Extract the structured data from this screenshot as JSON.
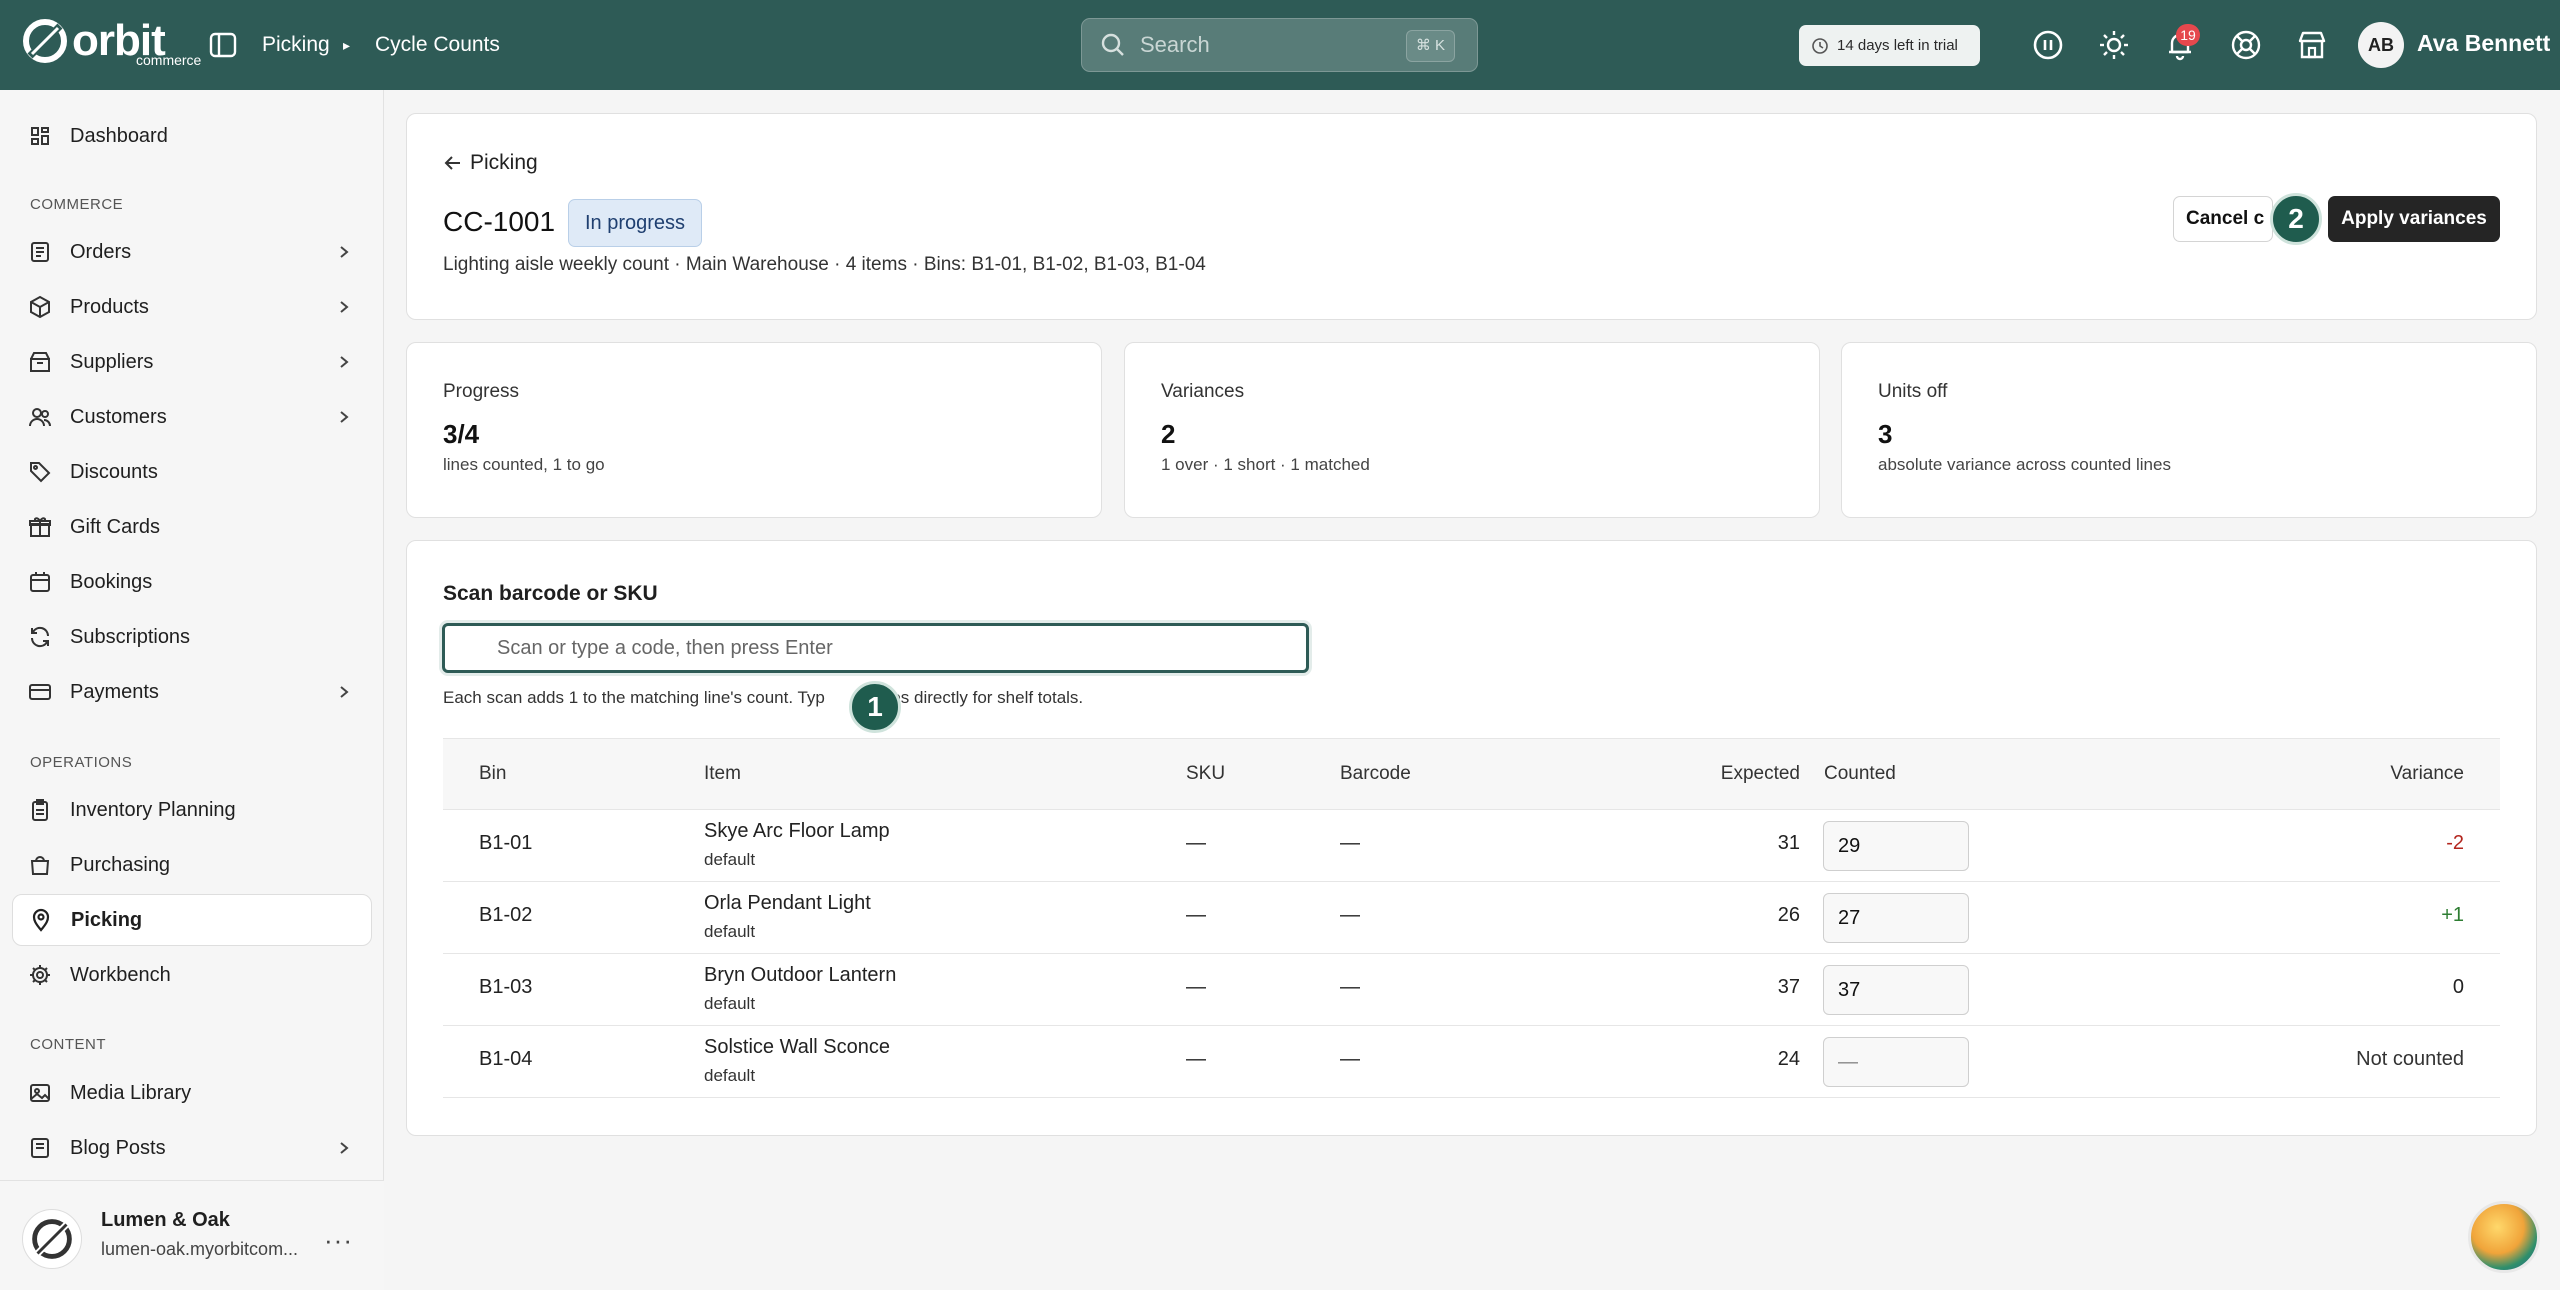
{
  "header": {
    "brand": "orbit",
    "brand_sub": "commerce",
    "breadcrumb": [
      "Picking",
      "Cycle Counts"
    ],
    "search_placeholder": "Search",
    "search_shortcut": "⌘ K",
    "trial_text": "14 days left in trial",
    "notifications_count": "19",
    "user_initials": "AB",
    "user_name": "Ava Bennett"
  },
  "sidebar": {
    "items": [
      {
        "label": "Dashboard",
        "icon": "dashboard-icon"
      },
      {
        "label": "Orders",
        "icon": "orders-icon"
      },
      {
        "label": "Products",
        "icon": "products-icon"
      },
      {
        "label": "Suppliers",
        "icon": "suppliers-icon"
      },
      {
        "label": "Customers",
        "icon": "customers-icon"
      },
      {
        "label": "Discounts",
        "icon": "tag-icon"
      },
      {
        "label": "Gift Cards",
        "icon": "gift-icon"
      },
      {
        "label": "Bookings",
        "icon": "calendar-icon"
      },
      {
        "label": "Subscriptions",
        "icon": "refresh-icon"
      },
      {
        "label": "Payments",
        "icon": "card-icon"
      },
      {
        "label": "Inventory Planning",
        "icon": "clipboard-icon"
      },
      {
        "label": "Purchasing",
        "icon": "bag-icon"
      },
      {
        "label": "Picking",
        "icon": "pin-icon"
      },
      {
        "label": "Workbench",
        "icon": "gear-icon"
      },
      {
        "label": "Media Library",
        "icon": "image-icon"
      },
      {
        "label": "Blog Posts",
        "icon": "doc-icon"
      }
    ],
    "sections": {
      "commerce": "COMMERCE",
      "operations": "OPERATIONS",
      "content": "CONTENT"
    },
    "store_name": "Lumen & Oak",
    "store_url": "lumen-oak.myorbitcom..."
  },
  "page": {
    "back_label": "Picking",
    "count_id": "CC-1001",
    "status": "In progress",
    "meta": "Lighting aisle weekly count · Main Warehouse · 4 items · Bins: B1-01, B1-02, B1-03, B1-04",
    "cancel_label": "Cancel c",
    "apply_label": "Apply variances",
    "marker_1": "1",
    "marker_2": "2"
  },
  "stats": [
    {
      "label": "Progress",
      "value": "3/4",
      "sub": "lines counted, 1 to go"
    },
    {
      "label": "Variances",
      "value": "2",
      "sub": "1 over · 1 short · 1 matched"
    },
    {
      "label": "Units off",
      "value": "3",
      "sub": "absolute variance across counted lines"
    }
  ],
  "scan": {
    "title": "Scan barcode or SKU",
    "placeholder": "Scan or type a code, then press Enter",
    "help_a": "Each scan adds 1 to the matching line's count. Typ",
    "help_b": "ntities directly for shelf totals."
  },
  "table": {
    "headers": [
      "Bin",
      "Item",
      "SKU",
      "Barcode",
      "Expected",
      "Counted",
      "Variance"
    ],
    "rows": [
      {
        "bin": "B1-01",
        "item": "Skye Arc Floor Lamp",
        "variant": "default",
        "sku": "—",
        "barcode": "—",
        "expected": "31",
        "counted": "29",
        "variance": "-2",
        "variance_color": "#b3261e"
      },
      {
        "bin": "B1-02",
        "item": "Orla Pendant Light",
        "variant": "default",
        "sku": "—",
        "barcode": "—",
        "expected": "26",
        "counted": "27",
        "variance": "+1",
        "variance_color": "#2e7d32"
      },
      {
        "bin": "B1-03",
        "item": "Bryn Outdoor Lantern",
        "variant": "default",
        "sku": "—",
        "barcode": "—",
        "expected": "37",
        "counted": "37",
        "variance": "0",
        "variance_color": "#222222"
      },
      {
        "bin": "B1-04",
        "item": "Solstice Wall Sconce",
        "variant": "default",
        "sku": "—",
        "barcode": "—",
        "expected": "24",
        "counted": "—",
        "variance": "Not counted",
        "variance_color": "#333333"
      }
    ]
  }
}
